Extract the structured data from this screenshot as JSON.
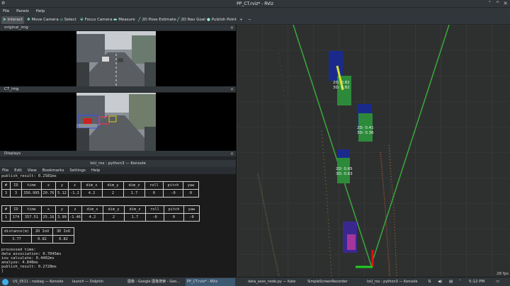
{
  "window": {
    "title": "PP_CT.rviz* - RViz",
    "icon": "rviz-logo-icon",
    "buttons": [
      "˅",
      "^",
      "✕"
    ]
  },
  "menubar": [
    "File",
    "Panels",
    "Help"
  ],
  "toolbar": {
    "tools": [
      {
        "label": "Interact",
        "icon": "cursor-icon",
        "active": true
      },
      {
        "label": "Move Camera",
        "icon": "move-icon"
      },
      {
        "label": "Select",
        "icon": "select-icon"
      },
      {
        "label": "Focus Camera",
        "icon": "focus-icon"
      },
      {
        "label": "Measure",
        "icon": "measure-icon"
      },
      {
        "label": "2D Pose Estimate",
        "icon": "pose-arrow-icon"
      },
      {
        "label": "2D Nav Goal",
        "icon": "nav-goal-icon"
      },
      {
        "label": "Publish Point",
        "icon": "pin-icon"
      }
    ],
    "add": "+",
    "remove": "−"
  },
  "panels": {
    "original_img": "original_img",
    "ct_img": "CT_img",
    "displays": "Displays"
  },
  "konsole": {
    "title": "IoU_ros : python3 — Konsole",
    "menu": [
      "File",
      "Edit",
      "View",
      "Bookmarks",
      "Settings",
      "Help"
    ],
    "lines_top": [
      "publish_result: 0.2581ms"
    ],
    "table1": {
      "headers": [
        "#",
        "ID",
        "time",
        "x",
        "y",
        "z",
        "dim_x",
        "dim_y",
        "dim_z",
        "roll",
        "pitch",
        "yaw"
      ],
      "row": [
        "3",
        "3",
        "356.995",
        "20.76",
        "5.12",
        "-1.2",
        "4.2",
        "2",
        "1.7",
        "0",
        "-0",
        "0"
      ]
    },
    "table2": {
      "headers": [
        "#",
        "ID",
        "time",
        "x",
        "y",
        "z",
        "dim_x",
        "dim_y",
        "dim_z",
        "roll",
        "pitch",
        "yaw"
      ],
      "row": [
        "1",
        "174",
        "357.51",
        "25.16",
        "3.99",
        "-1.46",
        "4.2",
        "2",
        "1.7",
        "-0",
        "0",
        "-0"
      ]
    },
    "table3": {
      "headers": [
        "distance(m)",
        "2D IoU",
        "3D IoU"
      ],
      "row": [
        "3.77",
        "0.82",
        "0.82"
      ]
    },
    "lines_bottom": [
      "processed time:",
      "data association: 0.7045ms",
      "iou calculate: 0.4402ms",
      "analyze: 4.846ms",
      "publish_result: 0.2728ms",
      "]"
    ]
  },
  "rviz": {
    "fps": "28 fps",
    "labels": [
      {
        "l1": "2D: 0.82",
        "l2": "3D: 0.82"
      },
      {
        "l1": "2D: 0.41",
        "l2": "3D: 0.36"
      },
      {
        "l1": "2D: 0.65",
        "l2": "3D: 0.63"
      }
    ]
  },
  "taskbar": {
    "items": [
      "US_0511 : rosbag — Konsole",
      "launch — Dolphin",
      "图像 - Google 图像搜索 - Goo...",
      "PP_CT.rviz* - RViz",
      "data_asso_node.py — Kate",
      "SimpleScreenRecorder",
      "IoU_ros : python3 — Konsole"
    ],
    "time": "5:12 PM"
  },
  "colors": {
    "grid": "#4a4c4b",
    "green_ray": "#3aa83a",
    "box_blue": "#1a2a8c",
    "box_green": "#2d8a3a"
  }
}
